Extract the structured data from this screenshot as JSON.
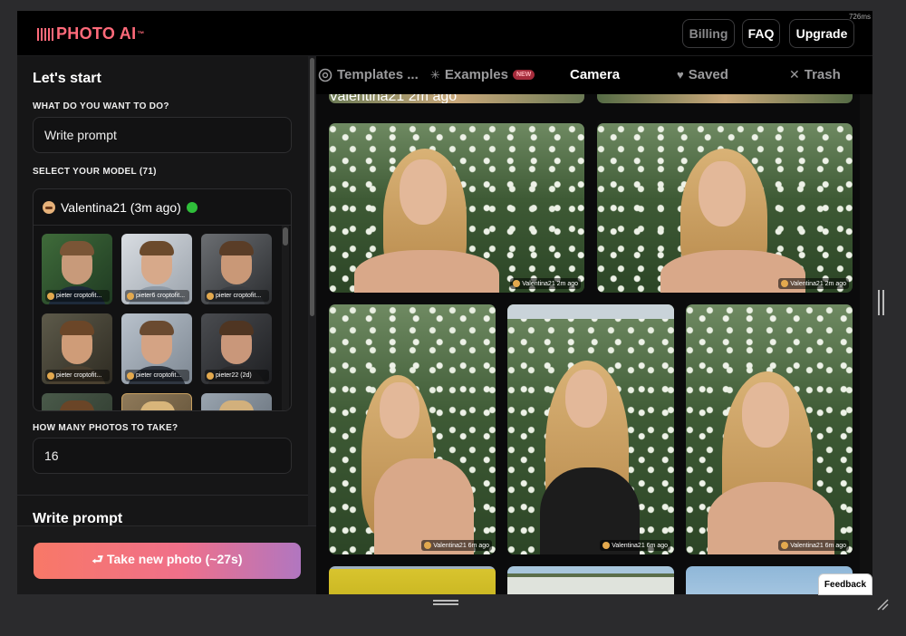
{
  "app": {
    "brand": "PHOTO AI",
    "brand_tm": "™",
    "perf": "726ms"
  },
  "header": {
    "billing": "Billing",
    "faq": "FAQ",
    "upgrade": "Upgrade"
  },
  "sidebar": {
    "title": "Let's start",
    "what_label": "WHAT DO YOU WANT TO DO?",
    "what_value": "Write prompt",
    "model_label": "SELECT YOUR MODEL (71)",
    "selected_model": "Valentina21 (3m ago)",
    "models": [
      {
        "caption": "pieter croptofit..."
      },
      {
        "caption": "pieter6 croptofit..."
      },
      {
        "caption": "pieter croptofit..."
      },
      {
        "caption": "pieter croptofit..."
      },
      {
        "caption": "pieter croptofit..."
      },
      {
        "caption": "pieter22 (2d)"
      }
    ],
    "count_label": "HOW MANY PHOTOS TO TAKE?",
    "count_value": "16",
    "section2_title": "Write prompt",
    "cta": "⮐ Take new photo (~27s)"
  },
  "tabs": [
    {
      "label": "Templates ...",
      "icon": "openai-icon"
    },
    {
      "label": "Examples",
      "badge": "NEW",
      "icon": "sparkle-icon"
    },
    {
      "label": "Camera",
      "active": true
    },
    {
      "label": "Saved",
      "icon": "heart-icon"
    },
    {
      "label": "Trash",
      "icon": "x-icon"
    }
  ],
  "gallery": {
    "top_strip_tag": "Valentina21 2m ago",
    "row1": [
      {
        "tag": "Valentina21 2m ago"
      },
      {
        "tag": "Valentina21 2m ago"
      }
    ],
    "row2": [
      {
        "tag": "Valentina21 6m ago"
      },
      {
        "tag": "Valentina21 6m ago"
      },
      {
        "tag": "Valentina21 6m ago"
      }
    ]
  },
  "feedback": "Feedback"
}
